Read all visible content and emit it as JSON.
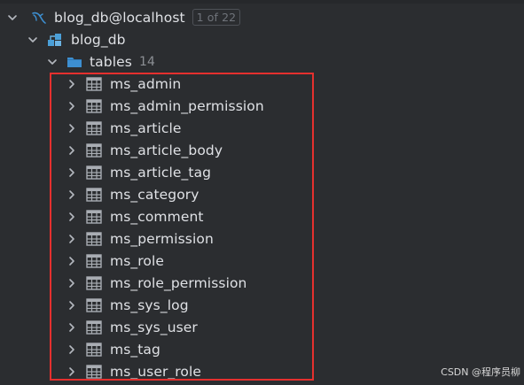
{
  "datasource": {
    "name": "blog_db@localhost",
    "badge": "1 of 22"
  },
  "schema": {
    "name": "blog_db"
  },
  "folder": {
    "name": "tables",
    "count": "14"
  },
  "tables": [
    "ms_admin",
    "ms_admin_permission",
    "ms_article",
    "ms_article_body",
    "ms_article_tag",
    "ms_category",
    "ms_comment",
    "ms_permission",
    "ms_role",
    "ms_role_permission",
    "ms_sys_log",
    "ms_sys_user",
    "ms_tag",
    "ms_user_role"
  ],
  "watermark": "CSDN @程序员柳",
  "colors": {
    "background": "#2b2d30",
    "highlight_border": "#e5302e",
    "datasource_icon": "#3d8fd1",
    "schema_icon": "#4a9fd8",
    "folder_icon": "#3d8fd1"
  },
  "icons": {
    "datasource": "mysql-dolphin-icon",
    "schema": "schema-icon",
    "folder": "folder-icon",
    "table": "table-icon",
    "expanded": "chevron-down-icon",
    "collapsed": "chevron-right-icon"
  }
}
